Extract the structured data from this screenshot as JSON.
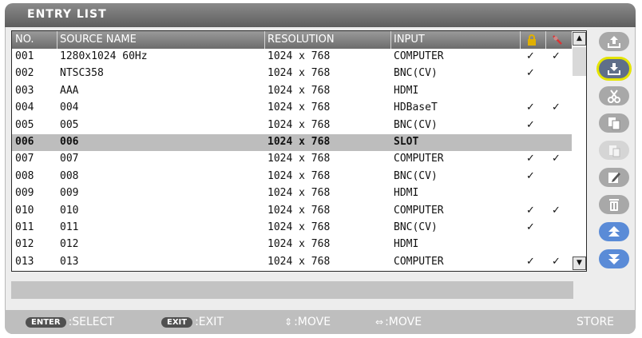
{
  "title": "ENTRY LIST",
  "columns": {
    "no": "NO.",
    "source_name": "SOURCE NAME",
    "resolution": "RESOLUTION",
    "input": "INPUT",
    "lock_icon": "lock-icon",
    "skip_icon": "skip-icon"
  },
  "check_mark": "✓",
  "rows": [
    {
      "no": "001",
      "name": "1280x1024 60Hz",
      "res": "1024 x 768",
      "input": "COMPUTER",
      "lock": "✓",
      "skip": "✓",
      "selected": false
    },
    {
      "no": "002",
      "name": "NTSC358",
      "res": "1024 x 768",
      "input": "BNC(CV)",
      "lock": "✓",
      "skip": "",
      "selected": false
    },
    {
      "no": "003",
      "name": "AAA",
      "res": "1024 x 768",
      "input": "HDMI",
      "lock": "",
      "skip": "",
      "selected": false
    },
    {
      "no": "004",
      "name": "004",
      "res": "1024 x 768",
      "input": "HDBaseT",
      "lock": "✓",
      "skip": "✓",
      "selected": false
    },
    {
      "no": "005",
      "name": "005",
      "res": "1024 x 768",
      "input": "BNC(CV)",
      "lock": "✓",
      "skip": "",
      "selected": false
    },
    {
      "no": "006",
      "name": "006",
      "res": "1024 x 768",
      "input": "SLOT",
      "lock": "",
      "skip": "",
      "selected": true
    },
    {
      "no": "007",
      "name": "007",
      "res": "1024 x 768",
      "input": "COMPUTER",
      "lock": "✓",
      "skip": "✓",
      "selected": false
    },
    {
      "no": "008",
      "name": "008",
      "res": "1024 x 768",
      "input": "BNC(CV)",
      "lock": "✓",
      "skip": "",
      "selected": false
    },
    {
      "no": "009",
      "name": "009",
      "res": "1024 x 768",
      "input": "HDMI",
      "lock": "",
      "skip": "",
      "selected": false
    },
    {
      "no": "010",
      "name": "010",
      "res": "1024 x 768",
      "input": "COMPUTER",
      "lock": "✓",
      "skip": "✓",
      "selected": false
    },
    {
      "no": "011",
      "name": "011",
      "res": "1024 x 768",
      "input": "BNC(CV)",
      "lock": "✓",
      "skip": "",
      "selected": false
    },
    {
      "no": "012",
      "name": "012",
      "res": "1024 x 768",
      "input": "HDMI",
      "lock": "",
      "skip": "",
      "selected": false
    },
    {
      "no": "013",
      "name": "013",
      "res": "1024 x 768",
      "input": "COMPUTER",
      "lock": "✓",
      "skip": "✓",
      "selected": false
    }
  ],
  "toolbar": [
    {
      "icon": "load-icon",
      "state": "normal"
    },
    {
      "icon": "save-icon",
      "state": "active"
    },
    {
      "icon": "cut-icon",
      "state": "normal"
    },
    {
      "icon": "copy-icon",
      "state": "normal"
    },
    {
      "icon": "paste-icon",
      "state": "disabled"
    },
    {
      "icon": "edit-icon",
      "state": "normal"
    },
    {
      "icon": "delete-icon",
      "state": "normal"
    },
    {
      "icon": "page-up-icon",
      "state": "blue"
    },
    {
      "icon": "page-down-icon",
      "state": "blue"
    }
  ],
  "footer": {
    "enter_key": "ENTER",
    "select_label": ":SELECT",
    "exit_key": "EXIT",
    "exit_label": ":EXIT",
    "updown_arrows": "⇕",
    "updown_label": ":MOVE",
    "leftright_arrows": "⇔",
    "leftright_label": ":MOVE",
    "store_label": "STORE"
  },
  "colors": {
    "selection": "#bdbdbd",
    "active_outline": "#e4e400",
    "blue_button": "#5a8bd7"
  }
}
